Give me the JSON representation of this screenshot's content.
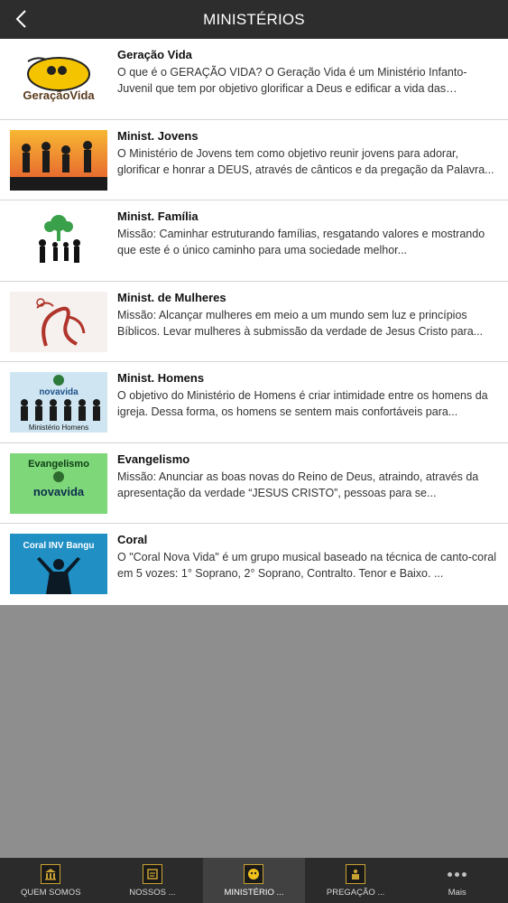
{
  "header": {
    "title": "MINISTÉRIOS"
  },
  "items": [
    {
      "title": "Geração Vida",
      "desc": "O que é o GERAÇÃO VIDA? O Geração Vida é um Ministério Infanto-Juvenil que tem por objetivo glorificar a Deus e edificar a vida das crianças...",
      "thumb_text": "GeraçãoVida"
    },
    {
      "title": "Minist. Jovens",
      "desc": "O Ministério de Jovens tem como objetivo reunir jovens para adorar, glorificar e honrar a DEUS, através de cânticos e da pregação da Palavra..."
    },
    {
      "title": "Minist. Família",
      "desc": "Missão: Caminhar estruturando famílias, resgatando valores e mostrando que este é o único caminho para uma sociedade melhor..."
    },
    {
      "title": "Minist. de Mulheres",
      "desc": "Missão: Alcançar mulheres em meio a um mundo sem luz e princípios Bíblicos. Levar mulheres à submissão da verdade de Jesus Cristo para..."
    },
    {
      "title": "Minist. Homens",
      "desc": "O objetivo do Ministério de Homens é criar intimidade entre os homens da igreja. Dessa forma, os homens se sentem mais confortáveis para...",
      "thumb_text": "novavida",
      "thumb_sub": "Ministério Homens"
    },
    {
      "title": "Evangelismo",
      "desc": "Missão: Anunciar as boas novas do Reino de Deus, atraindo, através da apresentação da verdade “JESUS CRISTO”, pessoas para se...",
      "thumb_text": "Evangelismo",
      "thumb_sub": "novavida"
    },
    {
      "title": "Coral",
      "desc": "O \"Coral Nova Vida\" é um grupo musical baseado na técnica de canto-coral em 5 vozes: 1° Soprano, 2° Soprano, Contralto. Tenor e Baixo. ...",
      "thumb_text": "Coral INV Bangu"
    }
  ],
  "tabs": [
    {
      "label": "QUEM SOMOS",
      "icon": "building-icon"
    },
    {
      "label": "NOSSOS ...",
      "icon": "book-icon"
    },
    {
      "label": "MINISTÉRIO ...",
      "icon": "group-icon"
    },
    {
      "label": "PREGAÇÃO ...",
      "icon": "pulpit-icon"
    },
    {
      "label": "Mais",
      "icon": "more-icon"
    }
  ],
  "colors": {
    "header_bg": "#2d2d2d",
    "tabbar_bg": "#2b2b2b",
    "accent_gold": "#c9a232",
    "empty_bg": "#8e8e8e"
  }
}
